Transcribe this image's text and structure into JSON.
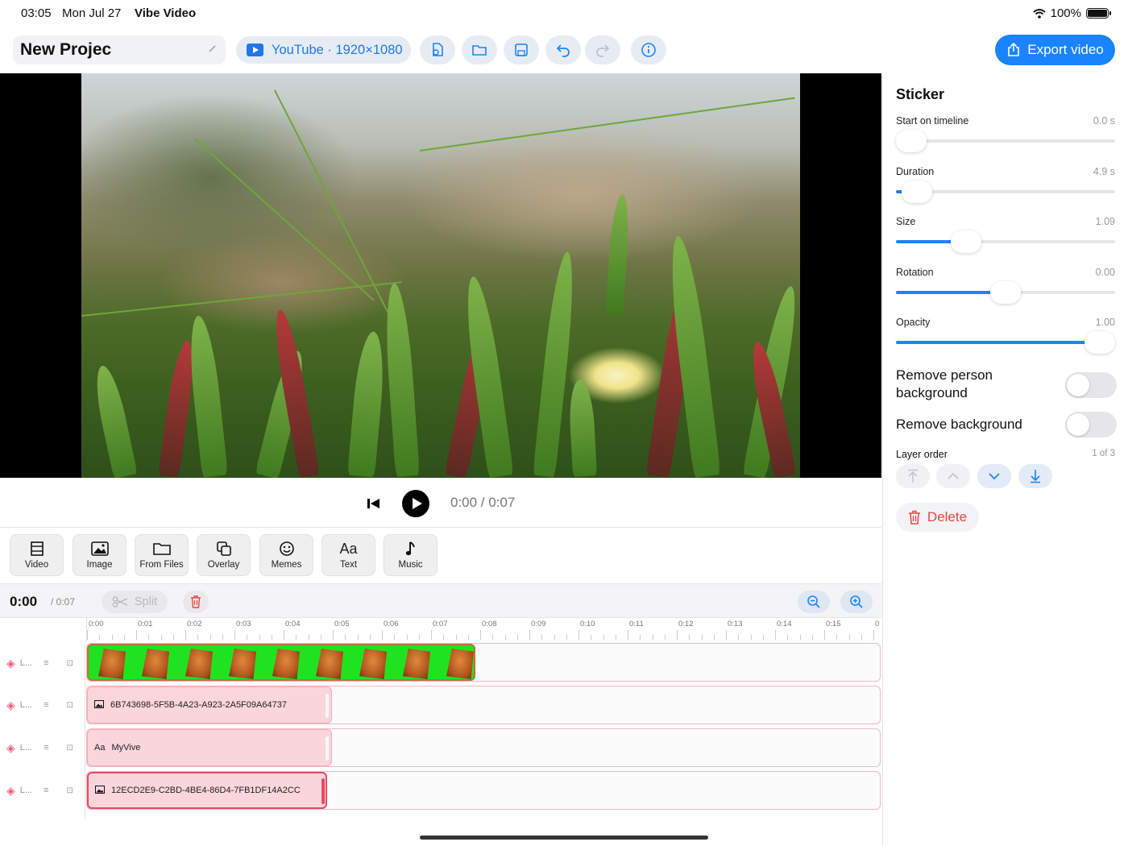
{
  "status": {
    "time": "03:05",
    "date": "Mon Jul 27",
    "app": "Vibe Video",
    "battery": "100%"
  },
  "toolbar": {
    "project_name": "New Projec",
    "format_label": "YouTube · 1920×1080",
    "export_label": "Export video",
    "icons": [
      "file-edit-icon",
      "folder-icon",
      "save-icon",
      "undo-icon",
      "redo-icon",
      "info-icon"
    ]
  },
  "player": {
    "time_readout": "0:00 / 0:07"
  },
  "tools": [
    {
      "label": "Video",
      "icon": "film-icon"
    },
    {
      "label": "Image",
      "icon": "image-icon"
    },
    {
      "label": "From Files",
      "icon": "folder-icon"
    },
    {
      "label": "Overlay",
      "icon": "overlay-icon"
    },
    {
      "label": "Memes",
      "icon": "smiley-icon"
    },
    {
      "label": "Text",
      "icon": "text-icon",
      "glyph": "Aa"
    },
    {
      "label": "Music",
      "icon": "music-note-icon"
    }
  ],
  "timeline": {
    "current": "0:00",
    "total": "/ 0:07",
    "split_label": "Split",
    "ruler": [
      "0:00",
      "0:01",
      "0:02",
      "0:03",
      "0:04",
      "0:05",
      "0:06",
      "0:07",
      "0:08",
      "0:09",
      "0:10",
      "0:11",
      "0:12",
      "0:13",
      "0:14",
      "0:15",
      "0"
    ],
    "lane_label": "L...",
    "lanes": [
      {
        "type": "filmstrip",
        "label": ""
      },
      {
        "type": "image",
        "label": "6B743698-5F5B-4A23-A923-2A5F09A64737"
      },
      {
        "type": "text",
        "glyph": "Aa",
        "label": "MyVive"
      },
      {
        "type": "image",
        "label": "12ECD2E9-C2BD-4BE4-86D4-7FB1DF14A2CC",
        "selected": true
      }
    ]
  },
  "panel": {
    "title": "Sticker",
    "sliders": [
      {
        "label": "Start on timeline",
        "value": "0.0 s",
        "fraction": 0.0
      },
      {
        "label": "Duration",
        "value": "4.9 s",
        "fraction": 0.03
      },
      {
        "label": "Size",
        "value": "1.09",
        "fraction": 0.29
      },
      {
        "label": "Rotation",
        "value": "0.00",
        "fraction": 0.5
      },
      {
        "label": "Opacity",
        "value": "1.00",
        "fraction": 1.0
      }
    ],
    "toggles": [
      {
        "label": "Remove person background",
        "on": false
      },
      {
        "label": "Remove background",
        "on": false
      }
    ],
    "layer_order_label": "Layer order",
    "layer_order_value": "1 of 3",
    "delete_label": "Delete"
  },
  "colors": {
    "accent": "#1a84ff",
    "danger": "#e94545",
    "track_border": "#f0b8c2",
    "clip_fill": "#fbd5dc"
  }
}
